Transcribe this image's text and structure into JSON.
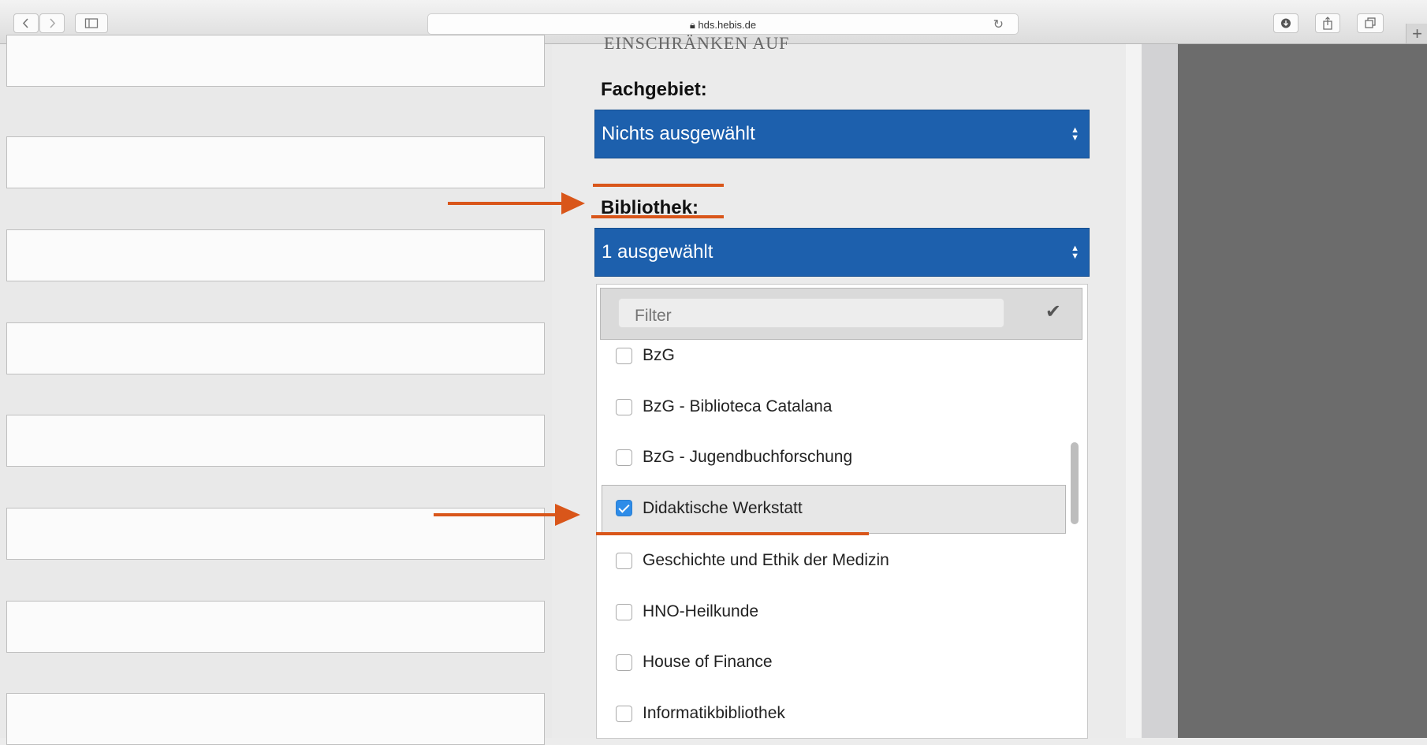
{
  "browser": {
    "url": "hds.hebis.de"
  },
  "page": {
    "cut_heading": "EINSCHRÄNKEN AUF",
    "fachgebiet": {
      "label": "Fachgebiet:",
      "value": "Nichts ausgewählt"
    },
    "bibliothek": {
      "label": "Bibliothek:",
      "value": "1 ausgewählt",
      "filter_placeholder": "Filter",
      "options": [
        {
          "label": "BzG",
          "checked": false
        },
        {
          "label": "BzG - Biblioteca Catalana",
          "checked": false
        },
        {
          "label": "BzG - Jugendbuchforschung",
          "checked": false
        },
        {
          "label": "Didaktische Werkstatt",
          "checked": true
        },
        {
          "label": "Geschichte und Ethik der Medizin",
          "checked": false
        },
        {
          "label": "HNO-Heilkunde",
          "checked": false
        },
        {
          "label": "House of Finance",
          "checked": false
        },
        {
          "label": "Informatikbibliothek",
          "checked": false
        }
      ]
    }
  },
  "colors": {
    "select_bg": "#1d60ad",
    "annotation": "#d9561a",
    "checkbox_checked": "#2e8ce8"
  }
}
